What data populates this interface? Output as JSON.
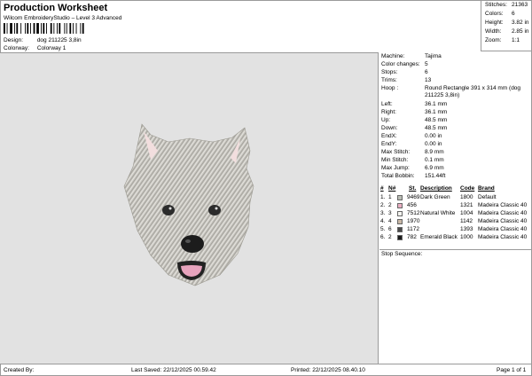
{
  "header": {
    "title": "Production Worksheet",
    "subtitle": "Wilcom EmbroideryStudio – Level 3 Advanced",
    "design_label": "Design:",
    "design_value": "dog 211225 3,8in",
    "colorway_label": "Colorway:",
    "colorway_value": "Colorway 1"
  },
  "stats": [
    {
      "label": "Stitches:",
      "value": "21363"
    },
    {
      "label": "Colors:",
      "value": "6"
    },
    {
      "label": "Height:",
      "value": "3.82 in"
    },
    {
      "label": "Width:",
      "value": "2.85 in"
    },
    {
      "label": "Zoom:",
      "value": "1:1"
    }
  ],
  "machine_info": [
    {
      "label": "Machine:",
      "value": "Tajima"
    },
    {
      "label": "Color changes:",
      "value": "5"
    },
    {
      "label": "Stops:",
      "value": "6"
    },
    {
      "label": "Trims:",
      "value": "13"
    },
    {
      "label": "Hoop :",
      "value": "Round Rectangle 391 x 314 mm (dog 211225 3,8in)"
    },
    {
      "label": "Left:",
      "value": "36.1 mm"
    },
    {
      "label": "Right:",
      "value": "36.1 mm"
    },
    {
      "label": "Up:",
      "value": "48.5 mm"
    },
    {
      "label": "Down:",
      "value": "48.5 mm"
    },
    {
      "label": "EndX:",
      "value": "0.00 in"
    },
    {
      "label": "EndY:",
      "value": "0.00 in"
    },
    {
      "label": "Max Stitch:",
      "value": "8.9 mm"
    },
    {
      "label": "Min Stitch:",
      "value": "0.1 mm"
    },
    {
      "label": "Max Jump:",
      "value": "6.9 mm"
    },
    {
      "label": "Total Bobbin:",
      "value": "151.44ft"
    }
  ],
  "color_table": {
    "headers": {
      "num": "#",
      "n": "N#",
      "st": "St.",
      "description": "Description",
      "code": "Code",
      "brand": "Brand"
    },
    "rows": [
      {
        "num": "1.",
        "n": "1",
        "st": "9469",
        "description": "Dark Green",
        "code": "1800",
        "brand": "Default",
        "color": "#b9bdb4"
      },
      {
        "num": "2.",
        "n": "2",
        "st": "456",
        "description": "",
        "code": "1321",
        "brand": "Madeira Classic 40",
        "color": "#e9aec2"
      },
      {
        "num": "3.",
        "n": "3",
        "st": "7512",
        "description": "Natural White",
        "code": "1004",
        "brand": "Madeira Classic 40",
        "color": "#f4f4f0"
      },
      {
        "num": "4.",
        "n": "4",
        "st": "1970",
        "description": "",
        "code": "1142",
        "brand": "Madeira Classic 40",
        "color": "#c9b8a6"
      },
      {
        "num": "5.",
        "n": "6",
        "st": "1172",
        "description": "",
        "code": "1393",
        "brand": "Madeira Classic 40",
        "color": "#4a4a4a"
      },
      {
        "num": "6.",
        "n": "2",
        "st": "782",
        "description": "Emerald Black",
        "code": "1000",
        "brand": "Madeira Classic 40",
        "color": "#1b1b1b"
      }
    ]
  },
  "stop_sequence_label": "Stop Sequence:",
  "footer": {
    "created_by": "Created By:",
    "last_saved": "Last Saved: 22/12/2025 00.59.42",
    "printed": "Printed: 22/12/2025 08.40.10",
    "page": "Page 1 of 1"
  }
}
